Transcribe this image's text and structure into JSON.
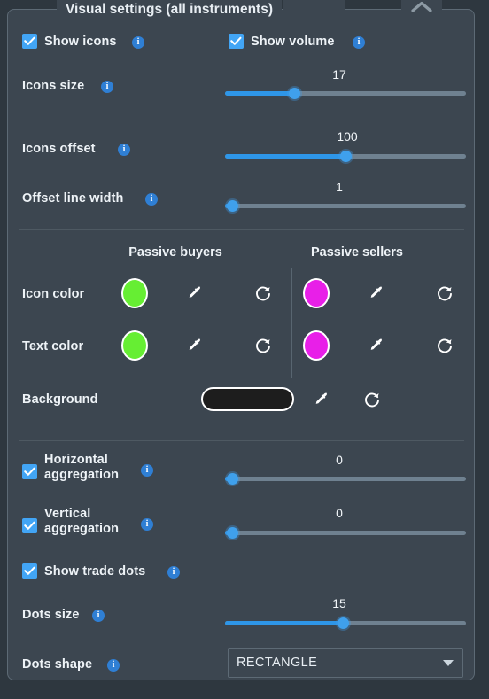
{
  "panel": {
    "title": "Visual settings (all instruments)",
    "collapse_icon": "chevron-up-icon",
    "accent_blue": "#2e96e8",
    "checkbox_blue": "#42a5f5",
    "info_blue": "#2f7fd4",
    "panel_bg": "#3c4650",
    "page_bg": "#2e373f",
    "border": "#5d6a75",
    "text": "#eef3f7"
  },
  "toggles": {
    "show_icons": {
      "label": "Show icons",
      "checked": true,
      "info": "info-icon"
    },
    "show_volume": {
      "label": "Show volume",
      "checked": true,
      "info": "info-icon"
    },
    "horizontal_aggregation": {
      "label": "Horizontal aggregation",
      "checked": true,
      "info": "info-icon"
    },
    "vertical_aggregation": {
      "label": "Vertical aggregation",
      "checked": true,
      "info": "info-icon"
    },
    "show_trade_dots": {
      "label": "Show trade dots",
      "checked": true,
      "info": "info-icon"
    }
  },
  "sliders": {
    "icons_size": {
      "label": "Icons size",
      "value": "17",
      "percent": 29
    },
    "icons_offset": {
      "label": "Icons offset",
      "value": "100",
      "percent": 50
    },
    "offset_line_width": {
      "label": "Offset line width",
      "value": "1",
      "percent": 3
    },
    "horizontal_aggregation": {
      "value": "0",
      "percent": 3
    },
    "vertical_aggregation": {
      "value": "0",
      "percent": 3
    },
    "dots_size": {
      "label": "Dots size",
      "value": "15",
      "percent": 49
    }
  },
  "colors": {
    "column_headers": [
      "Passive buyers",
      "Passive sellers"
    ],
    "rows": [
      {
        "label": "Icon color",
        "buyers": "#66ee33",
        "sellers": "#e81fe8",
        "picker_icon": "eyedropper-icon",
        "reset_icon": "reset-icon"
      },
      {
        "label": "Text color",
        "buyers": "#66ee33",
        "sellers": "#e81fe8",
        "picker_icon": "eyedropper-icon",
        "reset_icon": "reset-icon"
      }
    ],
    "background": {
      "label": "Background",
      "value": "#1d1d1d",
      "picker_icon": "eyedropper-icon",
      "reset_icon": "reset-icon"
    }
  },
  "dots_shape": {
    "label": "Dots shape",
    "value": "RECTANGLE",
    "info": "info-icon",
    "arrow": "chevron-down-icon"
  }
}
